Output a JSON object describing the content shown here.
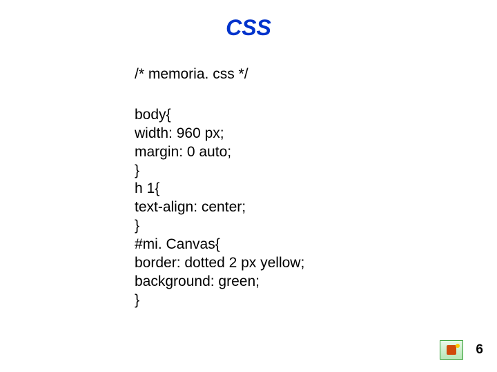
{
  "title": "CSS",
  "comment": "/*   memoria. css */",
  "code_lines": [
    "body{",
    "width: 960 px;",
    "margin: 0 auto;",
    "}",
    "h 1{",
    "text-align: center;",
    "}",
    "#mi. Canvas{",
    "border: dotted 2 px yellow;",
    "background: green;",
    "}"
  ],
  "page_number": "6"
}
